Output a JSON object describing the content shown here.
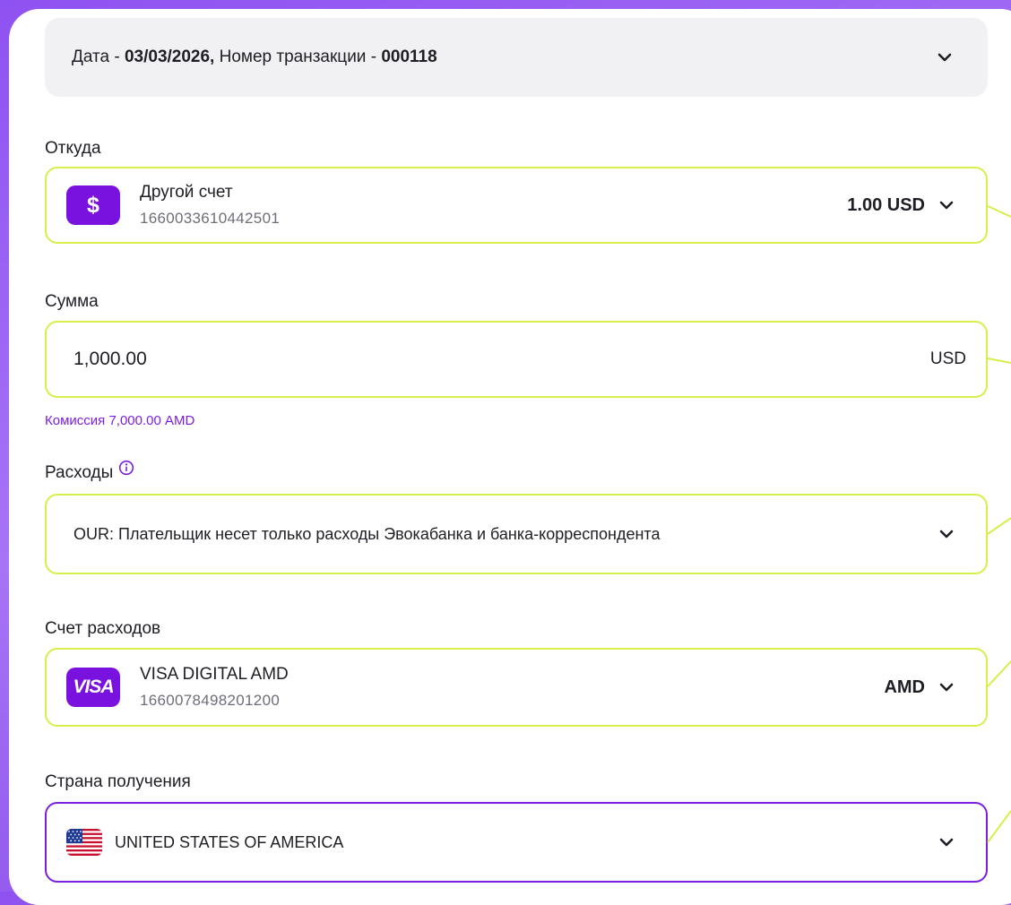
{
  "transaction": {
    "date_label": "Дата - ",
    "date_value": "03/03/2026,",
    "number_label": " Номер транзакции - ",
    "number_value": "000118"
  },
  "from": {
    "label": "Откуда",
    "account_name": "Другой счет",
    "account_number": "1660033610442501",
    "balance": "1.00 USD",
    "icon": "dollar-icon"
  },
  "amount": {
    "label": "Сумма",
    "value": "1,000.00",
    "currency": "USD",
    "fee": "Комиссия 7,000.00 AMD"
  },
  "charges": {
    "label": "Расходы",
    "selected": "OUR: Плательщик несет только расходы Эвокабанка и банка-корреспондента"
  },
  "charges_account": {
    "label": "Счет расходов",
    "account_name": "VISA DIGITAL AMD",
    "account_number": "1660078498201200",
    "currency": "AMD",
    "icon_text": "VISA"
  },
  "country": {
    "label": "Страна получения",
    "selected": "UNITED STATES OF AMERICA",
    "flag": "us-flag-icon"
  },
  "colors": {
    "accent": "#7a12df",
    "highlight_border": "#d9ee4a",
    "background_gradient": "#8f52f2"
  }
}
